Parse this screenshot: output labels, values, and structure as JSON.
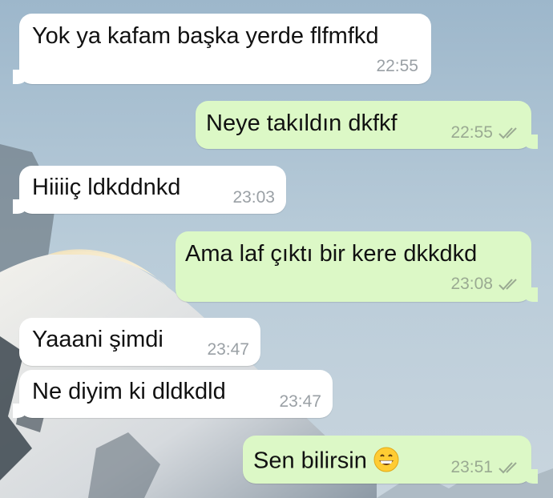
{
  "messages": [
    {
      "id": "m1",
      "direction": "incoming",
      "text": "Yok ya kafam başka yerde flfmfkd",
      "time": "22:55"
    },
    {
      "id": "m2",
      "direction": "outgoing",
      "text": "Neye takıldın dkfkf",
      "time": "22:55",
      "ticks": "read"
    },
    {
      "id": "m3",
      "direction": "incoming",
      "text": "Hiiiiç ldkddnkd",
      "time": "23:03"
    },
    {
      "id": "m4",
      "direction": "outgoing",
      "text": "Ama laf çıktı bir kere dkkdkd",
      "time": "23:08",
      "ticks": "read"
    },
    {
      "id": "m5",
      "direction": "incoming",
      "text": "Yaaani şimdi",
      "time": "23:47"
    },
    {
      "id": "m6",
      "direction": "incoming",
      "text": "Ne diyim ki dldkdld",
      "time": "23:47"
    },
    {
      "id": "m7",
      "direction": "outgoing",
      "text": "Sen bilirsin",
      "emoji": "grinning-face",
      "time": "23:51",
      "ticks": "read"
    }
  ],
  "colors": {
    "incoming_bubble": "#ffffff",
    "outgoing_bubble": "#dcf8c6",
    "tick": "#9aaa92"
  }
}
